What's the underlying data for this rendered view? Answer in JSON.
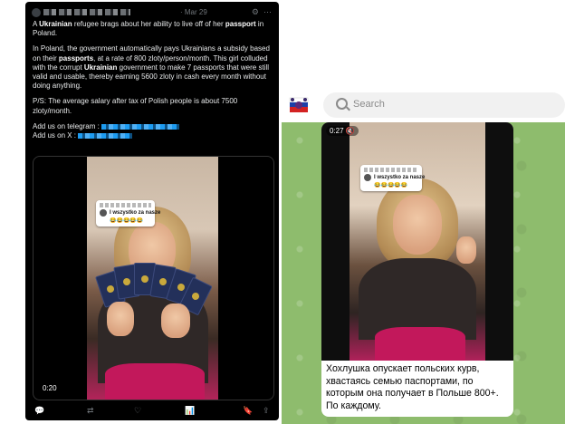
{
  "tweet": {
    "date": "· Mar 29",
    "gear_glyph": "⚙",
    "more_glyph": "⋯",
    "p1": [
      "A ",
      "Ukrainian",
      " refugee brags about her ability to live off of her ",
      "passport",
      " in Poland."
    ],
    "p2": [
      "In Poland, the government automatically pays Ukrainians a subsidy based on their ",
      "passports",
      ", at a rate of 800 zloty/person/month. This girl colluded with the corrupt ",
      "Ukrainian",
      " government to make 7 passports that were still valid and usable, thereby earning 5600 zloty in cash every month without doing anything."
    ],
    "p3": "P/S: The average salary after tax of Polish people is about 7500 zloty/month.",
    "telegram_label": "Add us on telegram : ",
    "x_label": "Add us on X : ",
    "video_time": "0:20",
    "video_caption": "I wszystko za nasze",
    "video_emojis": "😂😂😂😂😂",
    "actions": {
      "reply": "💬",
      "retweet": "⇄",
      "like": "♡",
      "views": "📊",
      "bookmark": "🔖",
      "share": "⇪"
    }
  },
  "telegram": {
    "search_placeholder": "Search",
    "video_time": "0:27",
    "video_caption": "I wszystko za nasze",
    "video_emojis": "😂😂😂😂😂",
    "caption": "Хохлушка опускает польских курв, хвастаясь семью паспортами, по которым она получает в Польше 800+. По каждому."
  }
}
